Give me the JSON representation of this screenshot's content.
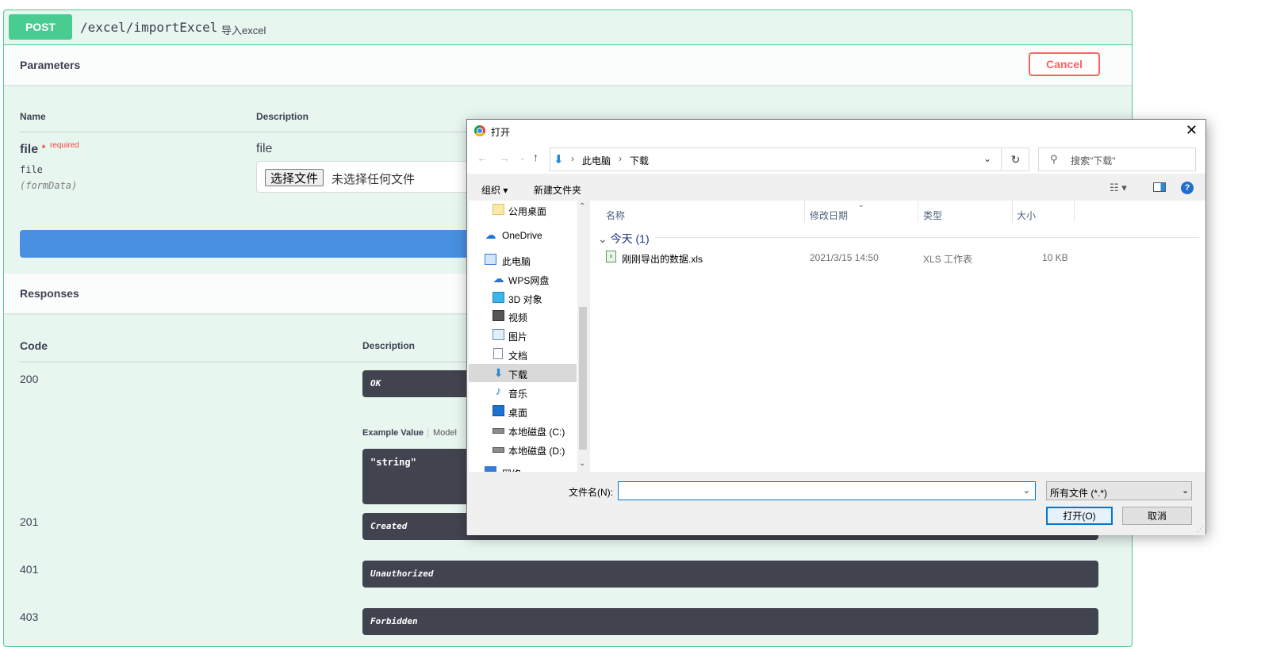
{
  "operation": {
    "method": "POST",
    "path": "/excel/importExcel",
    "summary": "导入excel"
  },
  "parameters": {
    "title": "Parameters",
    "cancel_label": "Cancel",
    "col_name": "Name",
    "col_description": "Description",
    "param": {
      "name": "file",
      "star": "*",
      "required": "required",
      "type": "file",
      "in": "(formData)",
      "description": "file",
      "choose_file_label": "选择文件",
      "no_file_text": "未选择任何文件"
    }
  },
  "responses": {
    "title": "Responses",
    "col_code": "Code",
    "col_description": "Description",
    "example_value_tab": "Example Value",
    "model_tab": "Model",
    "example_text": "\"string\"",
    "items": [
      {
        "code": "200",
        "description": "OK"
      },
      {
        "code": "201",
        "description": "Created"
      },
      {
        "code": "401",
        "description": "Unauthorized"
      },
      {
        "code": "403",
        "description": "Forbidden"
      }
    ]
  },
  "dialog": {
    "title": "打开",
    "breadcrumb": [
      "此电脑",
      "下载"
    ],
    "search_placeholder": "搜索\"下载\"",
    "toolbar": {
      "organize": "组织 ▾",
      "new_folder": "新建文件夹"
    },
    "tree": [
      {
        "label": "公用桌面",
        "icon": "folder-icon"
      },
      {
        "label": "OneDrive",
        "icon": "cloud-icon"
      },
      {
        "label": "此电脑",
        "icon": "computer-icon"
      },
      {
        "label": "WPS网盘",
        "icon": "cloud-icon"
      },
      {
        "label": "3D 对象",
        "icon": "cube-icon"
      },
      {
        "label": "视频",
        "icon": "video-icon"
      },
      {
        "label": "图片",
        "icon": "picture-icon"
      },
      {
        "label": "文档",
        "icon": "document-icon"
      },
      {
        "label": "下载",
        "icon": "download-icon"
      },
      {
        "label": "音乐",
        "icon": "music-icon"
      },
      {
        "label": "桌面",
        "icon": "desktop-icon"
      },
      {
        "label": "本地磁盘 (C:)",
        "icon": "drive-icon"
      },
      {
        "label": "本地磁盘 (D:)",
        "icon": "drive-icon"
      },
      {
        "label": "网络",
        "icon": "network-icon"
      }
    ],
    "columns": {
      "name": "名称",
      "date": "修改日期",
      "type": "类型",
      "size": "大小"
    },
    "group_label": "今天 (1)",
    "files": [
      {
        "name": "刚刚导出的数据.xls",
        "date": "2021/3/15 14:50",
        "type": "XLS 工作表",
        "size": "10 KB"
      }
    ],
    "filename_label": "文件名(N):",
    "filename_value": "",
    "filetype": "所有文件 (*.*)",
    "open_label": "打开(O)",
    "cancel_label": "取消"
  }
}
